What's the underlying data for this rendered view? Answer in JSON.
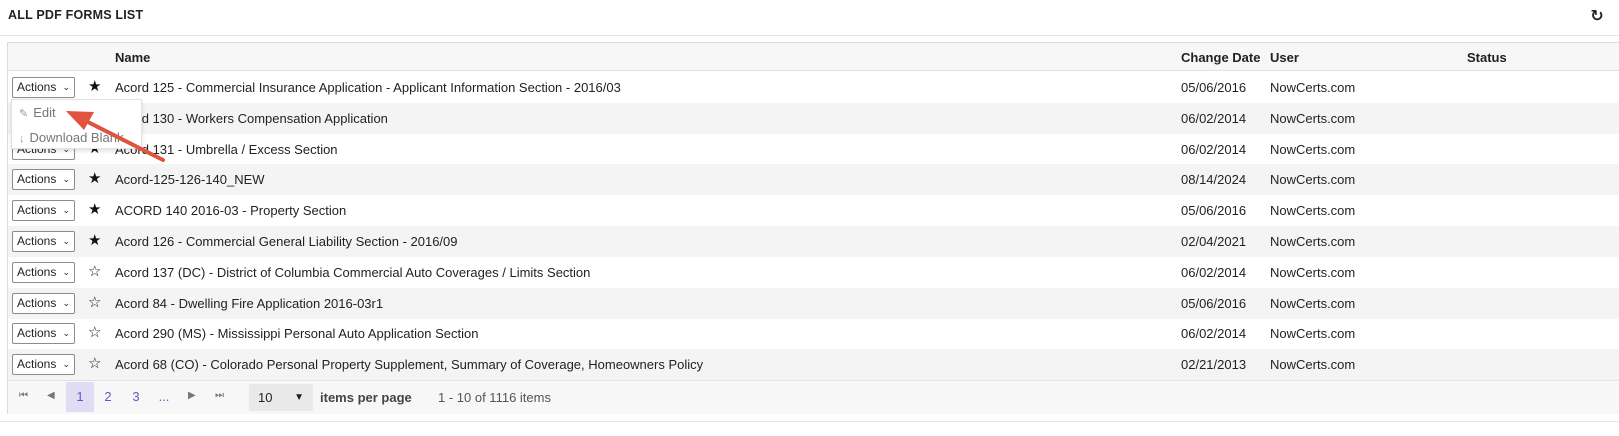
{
  "header": {
    "title": "ALL PDF FORMS LIST",
    "refresh_icon": "↻"
  },
  "grid": {
    "columns": {
      "name": "Name",
      "change_date": "Change Date",
      "user": "User",
      "status": "Status"
    },
    "action_label": "Actions",
    "rows": [
      {
        "name": "Acord 125 - Commercial Insurance Application - Applicant Information Section - 2016/03",
        "date": "05/06/2016",
        "user": "NowCerts.com",
        "status": "",
        "favorite": true
      },
      {
        "name": "Acord 130 - Workers Compensation Application",
        "date": "06/02/2014",
        "user": "NowCerts.com",
        "status": "",
        "favorite": true
      },
      {
        "name": "Acord 131 - Umbrella / Excess Section",
        "date": "06/02/2014",
        "user": "NowCerts.com",
        "status": "",
        "favorite": true
      },
      {
        "name": "Acord-125-126-140_NEW",
        "date": "08/14/2024",
        "user": "NowCerts.com",
        "status": "",
        "favorite": true
      },
      {
        "name": "ACORD 140 2016-03 - Property Section",
        "date": "05/06/2016",
        "user": "NowCerts.com",
        "status": "",
        "favorite": true
      },
      {
        "name": "Acord 126 - Commercial General Liability Section - 2016/09",
        "date": "02/04/2021",
        "user": "NowCerts.com",
        "status": "",
        "favorite": true
      },
      {
        "name": "Acord 137 (DC) - District of Columbia Commercial Auto Coverages / Limits Section",
        "date": "06/02/2014",
        "user": "NowCerts.com",
        "status": "",
        "favorite": false
      },
      {
        "name": "Acord 84 - Dwelling Fire Application 2016-03r1",
        "date": "05/06/2016",
        "user": "NowCerts.com",
        "status": "",
        "favorite": false
      },
      {
        "name": "Acord 290 (MS) - Mississippi Personal Auto Application Section",
        "date": "06/02/2014",
        "user": "NowCerts.com",
        "status": "",
        "favorite": false
      },
      {
        "name": "Acord 68 (CO) - Colorado Personal Property Supplement, Summary of Coverage, Homeowners Policy",
        "date": "02/21/2013",
        "user": "NowCerts.com",
        "status": "",
        "favorite": false
      }
    ]
  },
  "dropdown": {
    "edit": "Edit",
    "download_blank": "Download Blank"
  },
  "pager": {
    "pages": [
      "1",
      "2",
      "3",
      "..."
    ],
    "current": "1",
    "page_size": "10",
    "items_per_page_label": "items per page",
    "range_text": "1 - 10 of 1116 items"
  },
  "colors": {
    "accent": "#6b52c9",
    "annotation_arrow": "#e0533e"
  }
}
